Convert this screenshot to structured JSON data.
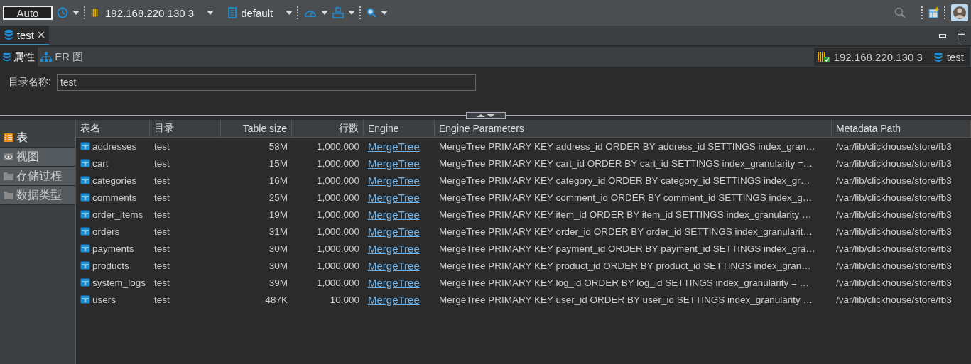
{
  "toolbar": {
    "transaction_mode": "Auto",
    "connection": "192.168.220.130 3",
    "schema": "default"
  },
  "editor_tabs": [
    {
      "label": "test",
      "selected": true
    }
  ],
  "sub_tabs": [
    {
      "label": "属性",
      "selected": true,
      "kind": "database"
    },
    {
      "label": "ER 图",
      "selected": false,
      "kind": "diagram"
    }
  ],
  "breadcrumb": {
    "connection": "192.168.220.130 3",
    "database": "test"
  },
  "form": {
    "label": "目录名称:",
    "value": "test"
  },
  "side_tabs": [
    {
      "label": "表",
      "selected": true,
      "kind": "table"
    },
    {
      "label": "视图",
      "selected": false,
      "kind": "view"
    },
    {
      "label": "存储过程",
      "selected": false,
      "kind": "folder"
    },
    {
      "label": "数据类型",
      "selected": false,
      "kind": "folder"
    }
  ],
  "table": {
    "columns": [
      "表名",
      "目录",
      "Table size",
      "行数",
      "Engine",
      "Engine Parameters",
      "Metadata Path"
    ],
    "rows": [
      [
        "addresses",
        "test",
        "58M",
        "1,000,000",
        "MergeTree",
        "MergeTree PRIMARY KEY address_id ORDER BY address_id SETTINGS index_gran…",
        "/var/lib/clickhouse/store/fb3"
      ],
      [
        "cart",
        "test",
        "15M",
        "1,000,000",
        "MergeTree",
        "MergeTree PRIMARY KEY cart_id ORDER BY cart_id SETTINGS index_granularity =…",
        "/var/lib/clickhouse/store/fb3"
      ],
      [
        "categories",
        "test",
        "16M",
        "1,000,000",
        "MergeTree",
        "MergeTree PRIMARY KEY category_id ORDER BY category_id SETTINGS index_gr…",
        "/var/lib/clickhouse/store/fb3"
      ],
      [
        "comments",
        "test",
        "25M",
        "1,000,000",
        "MergeTree",
        "MergeTree PRIMARY KEY comment_id ORDER BY comment_id SETTINGS index_g…",
        "/var/lib/clickhouse/store/fb3"
      ],
      [
        "order_items",
        "test",
        "19M",
        "1,000,000",
        "MergeTree",
        "MergeTree PRIMARY KEY item_id ORDER BY item_id SETTINGS index_granularity …",
        "/var/lib/clickhouse/store/fb3"
      ],
      [
        "orders",
        "test",
        "31M",
        "1,000,000",
        "MergeTree",
        "MergeTree PRIMARY KEY order_id ORDER BY order_id SETTINGS index_granularit…",
        "/var/lib/clickhouse/store/fb3"
      ],
      [
        "payments",
        "test",
        "30M",
        "1,000,000",
        "MergeTree",
        "MergeTree PRIMARY KEY payment_id ORDER BY payment_id SETTINGS index_gra…",
        "/var/lib/clickhouse/store/fb3"
      ],
      [
        "products",
        "test",
        "30M",
        "1,000,000",
        "MergeTree",
        "MergeTree PRIMARY KEY product_id ORDER BY product_id SETTINGS index_gran…",
        "/var/lib/clickhouse/store/fb3"
      ],
      [
        "system_logs",
        "test",
        "39M",
        "1,000,000",
        "MergeTree",
        "MergeTree PRIMARY KEY log_id ORDER BY log_id SETTINGS index_granularity = …",
        "/var/lib/clickhouse/store/fb3"
      ],
      [
        "users",
        "test",
        "487K",
        "10,000",
        "MergeTree",
        "MergeTree PRIMARY KEY user_id ORDER BY user_id SETTINGS index_granularity …",
        "/var/lib/clickhouse/store/fb3"
      ]
    ]
  }
}
